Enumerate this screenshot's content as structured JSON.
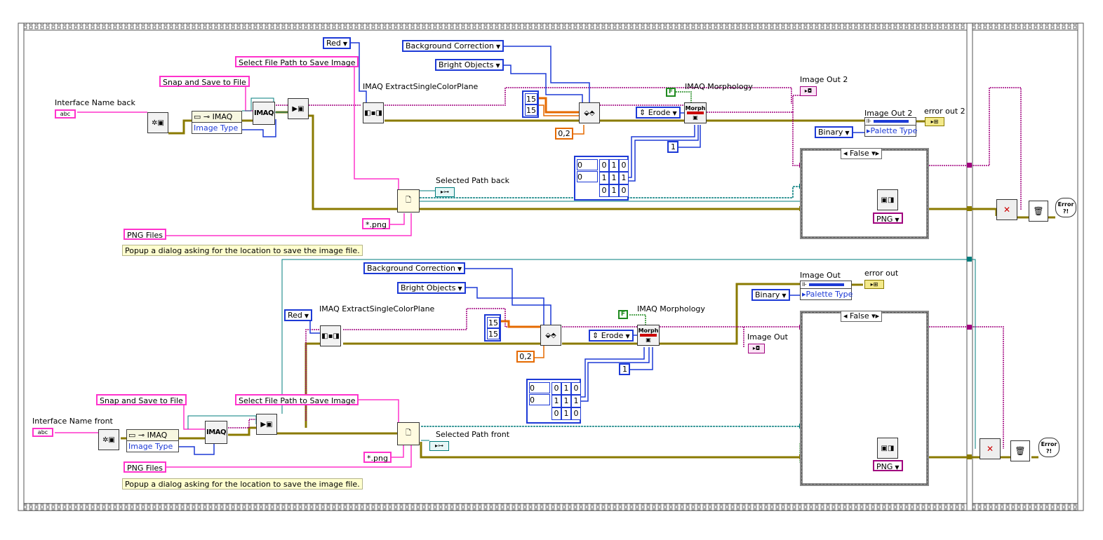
{
  "top": {
    "interface_name_label": "Interface Name back",
    "select_path_label": "Select File Path to Save Image",
    "snap_save_label": "Snap and Save to File",
    "extract_label": "IMAQ ExtractSingleColorPlane",
    "color_plane": "Red",
    "threshold_method": "Background Correction",
    "look_for": "Bright Objects",
    "window_w": "15",
    "window_h": "15",
    "deviation": "0,2",
    "morph_label": "IMAQ Morphology",
    "morph_bool": "F",
    "morph_op": "Erode",
    "morph_iter": "1",
    "struct_idx": [
      "0",
      "0"
    ],
    "struct_grid": [
      "0",
      "1",
      "0",
      "1",
      "1",
      "1",
      "0",
      "1",
      "0"
    ],
    "image_out_label": "Image Out 2",
    "image_out_bundle_label": "Image Out 2",
    "palette_type": "Palette Type",
    "palette_value": "Binary",
    "error_out_label": "error out 2",
    "selected_path_label": "Selected Path back",
    "pattern": "*.png",
    "png_files": "PNG Files",
    "comment": "Popup a dialog asking for the location to save the image file.",
    "case_value": "False",
    "format": "PNG",
    "imaq_text": "IMAQ",
    "image_type": "Image Type"
  },
  "bottom": {
    "interface_name_label": "Interface Name front",
    "select_path_label": "Select File Path to Save Image",
    "snap_save_label": "Snap and Save to File",
    "extract_label": "IMAQ ExtractSingleColorPlane",
    "color_plane": "Red",
    "threshold_method": "Background Correction",
    "look_for": "Bright Objects",
    "window_w": "15",
    "window_h": "15",
    "deviation": "0,2",
    "morph_label": "IMAQ Morphology",
    "morph_bool": "F",
    "morph_op": "Erode",
    "morph_iter": "1",
    "struct_idx": [
      "0",
      "0"
    ],
    "struct_grid": [
      "0",
      "1",
      "0",
      "1",
      "1",
      "1",
      "0",
      "1",
      "0"
    ],
    "image_out_label": "Image Out",
    "image_out_bundle_label": "Image Out",
    "palette_type": "Palette Type",
    "palette_value": "Binary",
    "error_out_label": "error out",
    "selected_path_label": "Selected Path front",
    "pattern": "*.png",
    "png_files": "PNG Files",
    "comment": "Popup a dialog asking for the location to save the image file.",
    "case_value": "False",
    "format": "PNG",
    "imaq_text": "IMAQ",
    "image_type": "Image Type"
  },
  "morph_text": "Morph",
  "error_text": "Error ?!",
  "colors": {
    "image_wire": "#a0007e",
    "error_wire": "#8a7a00",
    "path_wire": "#007c7c",
    "string_wire": "#ff33cc",
    "enum_wire": "#1d3ad6",
    "numeric_wire": "#e56a00",
    "frame": "#555555"
  }
}
